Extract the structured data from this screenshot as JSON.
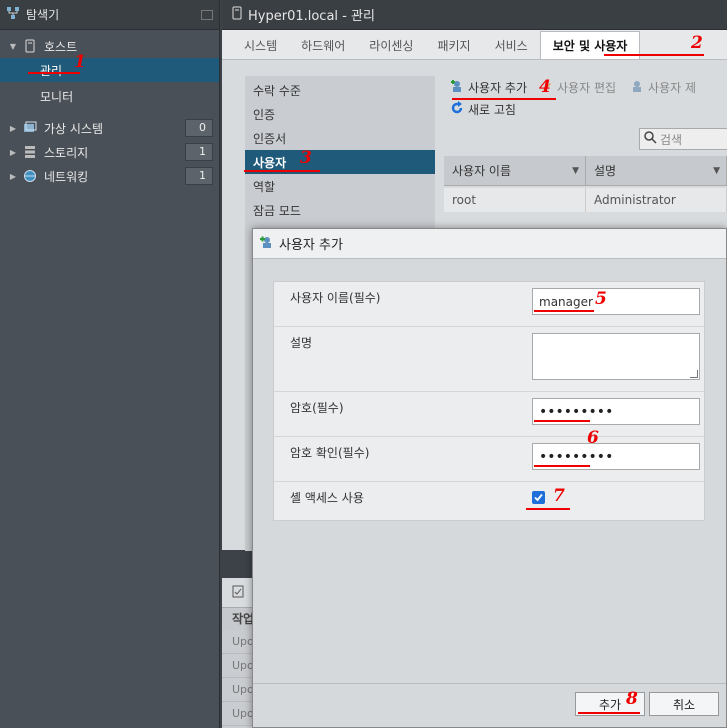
{
  "navigator": {
    "title": "탐색기",
    "host_label": "호스트",
    "items": [
      {
        "label": "관리",
        "selected": true
      },
      {
        "label": "모니터",
        "selected": false
      }
    ],
    "groups": [
      {
        "label": "가상 시스템",
        "count": "0"
      },
      {
        "label": "스토리지",
        "count": "1"
      },
      {
        "label": "네트워킹",
        "count": "1"
      }
    ]
  },
  "main": {
    "title": "Hyper01.local - 관리",
    "tabs": [
      "시스템",
      "하드웨어",
      "라이센싱",
      "패키지",
      "서비스",
      "보안 및 사용자"
    ],
    "active_tab": "보안 및 사용자"
  },
  "security_menu": {
    "items": [
      "수락 수준",
      "인증",
      "인증서",
      "사용자",
      "역할",
      "잠금 모드"
    ],
    "selected": "사용자"
  },
  "users_toolbar": {
    "add_user": "사용자 추가",
    "edit_user": "사용자 편집",
    "remove_user": "사용자 제",
    "refresh": "새로 고침",
    "search_placeholder": "검색"
  },
  "users_grid": {
    "columns": [
      "사용자 이름",
      "설명"
    ],
    "rows": [
      [
        "root",
        "Administrator"
      ]
    ]
  },
  "tasks": {
    "column": "작업",
    "rows": [
      "Upo",
      "Upo",
      "Upo",
      "Upo"
    ]
  },
  "dialog": {
    "title": "사용자 추가",
    "fields": {
      "username_label": "사용자 이름(필수)",
      "username_value": "manager",
      "description_label": "설명",
      "password_label": "암호(필수)",
      "password_value": "•••••••••",
      "confirm_label": "암호 확인(필수)",
      "confirm_value": "•••••••••",
      "shell_label": "셸 액세스 사용",
      "shell_checked": true
    },
    "add_button": "추가",
    "cancel_button": "취소"
  },
  "annotations": [
    "1",
    "2",
    "3",
    "4",
    "5",
    "6",
    "7",
    "8"
  ],
  "colors": {
    "selection": "#1f5a7a",
    "annotation": "#e00000",
    "checkbox": "#1e6fd9"
  }
}
